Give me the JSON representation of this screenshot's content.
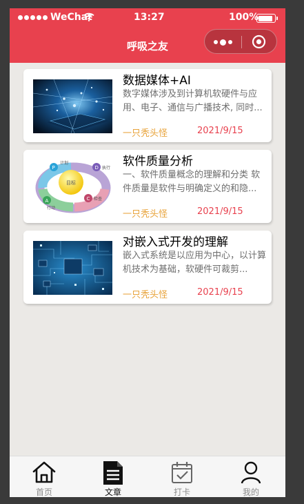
{
  "status_bar": {
    "carrier": "WeChat",
    "time": "13:27",
    "battery": "100%"
  },
  "nav": {
    "title": "呼吸之友",
    "more_icon": "more-dots-icon",
    "close_icon": "target-circle-icon"
  },
  "articles": [
    {
      "title": "数据媒体+AI",
      "desc": "数字媒体涉及到计算机软硬件与应用、电子、通信与广播技术, 同时...",
      "author": "一只秃头怪",
      "date": "2021/9/15",
      "thumb": "digital-media-image"
    },
    {
      "title": "软件质量分析",
      "desc": "一、软件质量概念的理解和分类 软件质量是软件与明确定义的和隐...",
      "author": "一只秃头怪",
      "date": "2021/9/15",
      "thumb": "pdca-cycle-image"
    },
    {
      "title": "对嵌入式开发的理解",
      "desc": "嵌入式系统是以应用为中心，以计算机技术为基础，软硬件可裁剪...",
      "author": "一只秃头怪",
      "date": "2021/9/15",
      "thumb": "circuit-board-image"
    }
  ],
  "pdca_labels": {
    "plan": "计划",
    "do": "执行",
    "check": "检查",
    "act": "行动",
    "goal": "目标"
  },
  "tabs": [
    {
      "label": "首页",
      "icon": "home-icon",
      "active": false
    },
    {
      "label": "文章",
      "icon": "document-icon",
      "active": true
    },
    {
      "label": "打卡",
      "icon": "calendar-check-icon",
      "active": false
    },
    {
      "label": "我的",
      "icon": "person-icon",
      "active": false
    }
  ],
  "colors": {
    "brand": "#e8414e",
    "author": "#e8a33a",
    "date": "#e8414e",
    "background": "#ebe9e6"
  }
}
